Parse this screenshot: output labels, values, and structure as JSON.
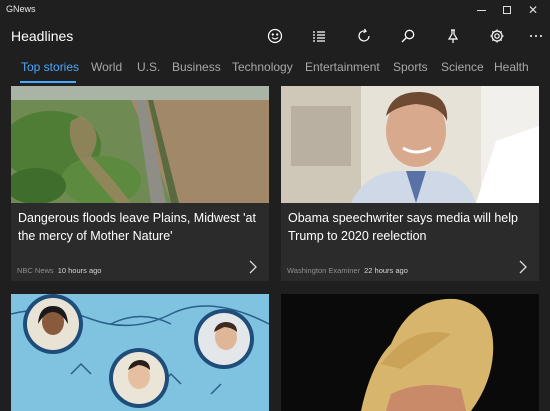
{
  "app": {
    "name": "GNews"
  },
  "window_controls": {
    "minimize": "minimize",
    "maximize": "maximize",
    "close": "✕"
  },
  "header": {
    "title": "Headlines",
    "icons": [
      "smiley-icon",
      "list-icon",
      "refresh-icon",
      "search-icon",
      "pin-icon",
      "gear-icon",
      "more-icon"
    ]
  },
  "tabs": [
    {
      "label": "Top stories",
      "active": true
    },
    {
      "label": "World",
      "active": false
    },
    {
      "label": "U.S.",
      "active": false
    },
    {
      "label": "Business",
      "active": false
    },
    {
      "label": "Technology",
      "active": false
    },
    {
      "label": "Entertainment",
      "active": false
    },
    {
      "label": "Sports",
      "active": false
    },
    {
      "label": "Science",
      "active": false
    },
    {
      "label": "Health",
      "active": false
    }
  ],
  "cards": [
    {
      "title": "Dangerous floods leave Plains, Midwest 'at the mercy of Mother Nature'",
      "source": "NBC News",
      "time": "10 hours ago",
      "image": "flooded-river-aerial-photo"
    },
    {
      "title": "Obama speechwriter says media will help Trump to 2020 reelection",
      "source": "Washington Examiner",
      "time": "22 hours ago",
      "image": "speechwriter-portrait-photo"
    },
    {
      "title": "",
      "source": "",
      "time": "",
      "image": "candidates-illustration"
    },
    {
      "title": "",
      "source": "",
      "time": "",
      "image": "trump-back-of-head-photo"
    }
  ],
  "colors": {
    "accent": "#4aa8ff",
    "background": "#1f1f1f",
    "card": "#2b2b2b"
  }
}
